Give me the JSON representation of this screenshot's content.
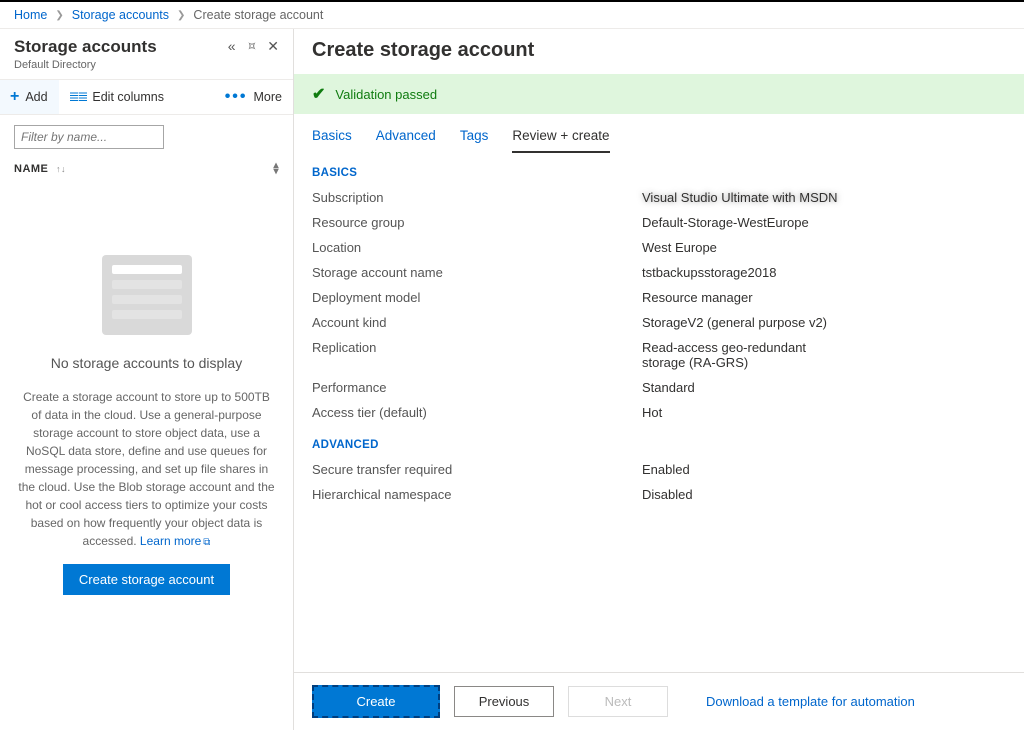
{
  "breadcrumb": {
    "home": "Home",
    "storage_accounts": "Storage accounts",
    "current": "Create storage account"
  },
  "left": {
    "title": "Storage accounts",
    "subtitle": "Default Directory",
    "toolbar": {
      "add": "Add",
      "edit_columns": "Edit columns",
      "more": "More"
    },
    "filter_placeholder": "Filter by name...",
    "column_name": "NAME",
    "empty": {
      "title": "No storage accounts to display",
      "body": "Create a storage account to store up to 500TB of data in the cloud. Use a general-purpose storage account to store object data, use a NoSQL data store, define and use queues for message processing, and set up file shares in the cloud. Use the Blob storage account and the hot or cool access tiers to optimize your costs based on how frequently your object data is accessed.",
      "learn_more": "Learn more",
      "button": "Create storage account"
    }
  },
  "right": {
    "title": "Create storage account",
    "validation": "Validation passed",
    "tabs": {
      "basics": "Basics",
      "advanced": "Advanced",
      "tags": "Tags",
      "review_create": "Review + create"
    },
    "sections": {
      "basics": {
        "heading": "BASICS",
        "rows": {
          "subscription": {
            "k": "Subscription",
            "v": "Visual Studio Ultimate with MSDN"
          },
          "resource_group": {
            "k": "Resource group",
            "v": "Default-Storage-WestEurope"
          },
          "location": {
            "k": "Location",
            "v": "West Europe"
          },
          "storage_name": {
            "k": "Storage account name",
            "v": "tstbackupsstorage2018"
          },
          "deployment_model": {
            "k": "Deployment model",
            "v": "Resource manager"
          },
          "account_kind": {
            "k": "Account kind",
            "v": "StorageV2 (general purpose v2)"
          },
          "replication": {
            "k": "Replication",
            "v": "Read-access geo-redundant storage (RA-GRS)"
          },
          "performance": {
            "k": "Performance",
            "v": "Standard"
          },
          "access_tier": {
            "k": "Access tier (default)",
            "v": "Hot"
          }
        }
      },
      "advanced": {
        "heading": "ADVANCED",
        "rows": {
          "secure_transfer": {
            "k": "Secure transfer required",
            "v": "Enabled"
          },
          "hierarchical_ns": {
            "k": "Hierarchical namespace",
            "v": "Disabled"
          }
        }
      }
    },
    "footer": {
      "create": "Create",
      "previous": "Previous",
      "next": "Next",
      "download_template": "Download a template for automation"
    }
  }
}
